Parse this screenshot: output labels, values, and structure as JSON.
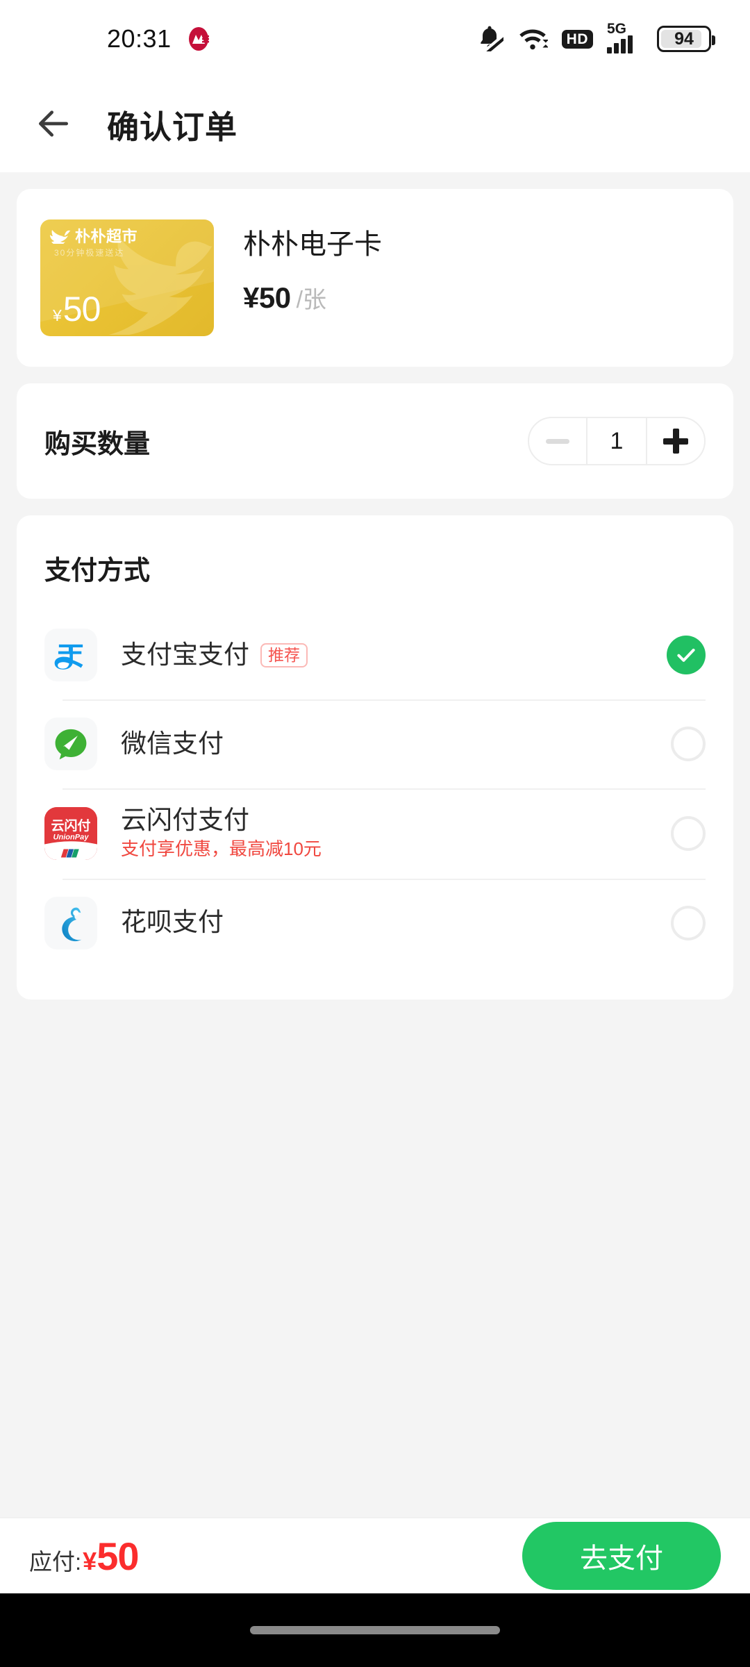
{
  "status_bar": {
    "time": "20:31",
    "carrier_icon": "motorola-logo-icon",
    "icons": [
      "bell-muted-icon",
      "wifi-icon",
      "hd-icon",
      "signal-5g-icon",
      "battery-icon"
    ],
    "hd_label": "HD",
    "network_label": "5G",
    "battery_level": "94"
  },
  "app_bar": {
    "back_icon": "arrow-left-icon",
    "title": "确认订单"
  },
  "product": {
    "name": "朴朴电子卡",
    "price": "¥50",
    "unit": "/张",
    "gift_card": {
      "brand": "朴朴超市",
      "tagline": "30分钟极速送达",
      "currency": "¥",
      "value": "50"
    }
  },
  "quantity": {
    "label": "购买数量",
    "value": "1",
    "minus_icon": "minus-icon",
    "plus_icon": "plus-icon"
  },
  "payment": {
    "title": "支付方式",
    "methods": [
      {
        "name": "支付宝支付",
        "badge": "推荐",
        "subtitle": "",
        "icon": "alipay-icon",
        "selected": true
      },
      {
        "name": "微信支付",
        "badge": "",
        "subtitle": "",
        "icon": "wechat-pay-icon",
        "selected": false
      },
      {
        "name": "云闪付支付",
        "badge": "",
        "subtitle": "支付享优惠，最高减10元",
        "icon": "unionpay-icon",
        "selected": false
      },
      {
        "name": "花呗支付",
        "badge": "",
        "subtitle": "",
        "icon": "huabei-icon",
        "selected": false
      }
    ],
    "unionpay_logo_text": "云闪付",
    "unionpay_logo_sub": "UnionPay"
  },
  "bottom_bar": {
    "total_label": "应付:",
    "total_currency": "¥",
    "total_amount": "50",
    "pay_button": "去支付"
  },
  "colors": {
    "accent_green": "#22c764",
    "price_red": "#fb2d2d",
    "promo_red": "#f0473f",
    "card_yellow": "#e9c233",
    "page_bg": "#f4f4f4"
  }
}
